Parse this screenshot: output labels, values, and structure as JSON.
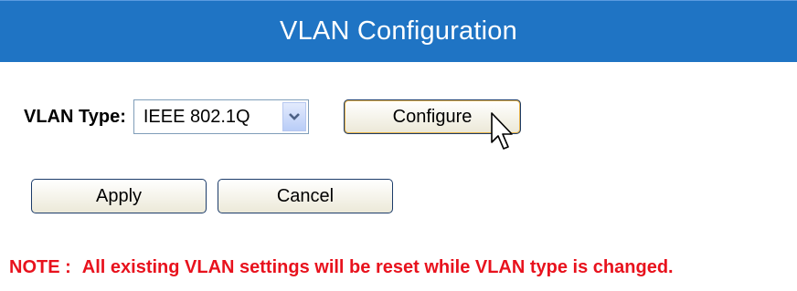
{
  "header": {
    "title": "VLAN Configuration"
  },
  "vlan_type": {
    "label": "VLAN Type:",
    "selected": "IEEE 802.1Q",
    "arrow_icon": "chevron-down-icon"
  },
  "buttons": {
    "configure": "Configure",
    "apply": "Apply",
    "cancel": "Cancel"
  },
  "note": {
    "prefix": "NOTE :",
    "text": "All existing VLAN settings will be reset while VLAN type is changed."
  },
  "colors": {
    "header_bg": "#1f74c4",
    "header_text": "#ffffff",
    "note_text": "#e8121d",
    "button_border": "#1c3c6a",
    "focus_border": "#e6b24a"
  }
}
